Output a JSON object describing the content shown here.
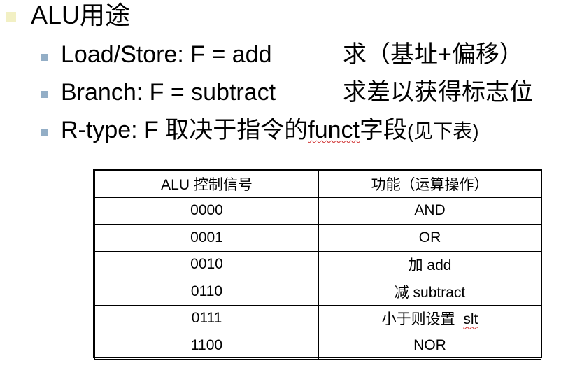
{
  "slide": {
    "title": "ALU用途",
    "bullets": [
      {
        "label": "Load/Store: F = add",
        "desc": "求（基址+偏移）"
      },
      {
        "label": "Branch: F = subtract",
        "desc": "求差以获得标志位"
      },
      {
        "label_prefix": "R-type: F 取决于指令的",
        "label_word": "funct",
        "label_suffix": "字段",
        "label_paren": "(见下表)"
      }
    ]
  },
  "table": {
    "headers": [
      "ALU 控制信号",
      "功能（运算操作）"
    ],
    "rows": [
      [
        "0000",
        "AND"
      ],
      [
        "0001",
        "OR"
      ],
      [
        "0010",
        "加 add"
      ],
      [
        "0110",
        "减 subtract"
      ],
      [
        "0111",
        "小于则设置  slt"
      ],
      [
        "1100",
        "NOR"
      ]
    ]
  }
}
